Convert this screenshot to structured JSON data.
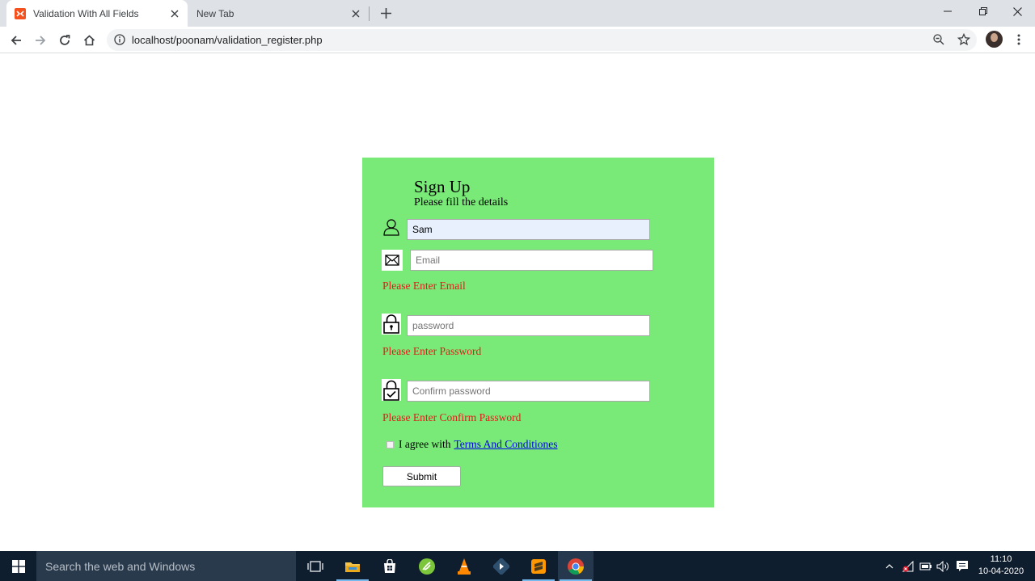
{
  "browser": {
    "tabs": [
      {
        "title": "Validation With All Fields",
        "active": true
      },
      {
        "title": "New Tab",
        "active": false
      }
    ],
    "url": "localhost/poonam/validation_register.php"
  },
  "form": {
    "title": "Sign Up",
    "subtitle": "Please fill the details",
    "name_value": "Sam",
    "email_placeholder": "Email",
    "email_error": "Please Enter Email",
    "password_placeholder": "password",
    "password_error": "Please Enter Password",
    "confirm_placeholder": "Confirm password",
    "confirm_error": "Please Enter Confirm Password",
    "agree_text": "I agree with",
    "terms_link": "Terms And Conditiones",
    "submit_label": "Submit",
    "colors": {
      "card_bg": "#79ea77",
      "error": "#e21b1b",
      "link": "#0000ee"
    }
  },
  "taskbar": {
    "search_placeholder": "Search the web and Windows",
    "time": "11:10",
    "date": "10-04-2020"
  }
}
